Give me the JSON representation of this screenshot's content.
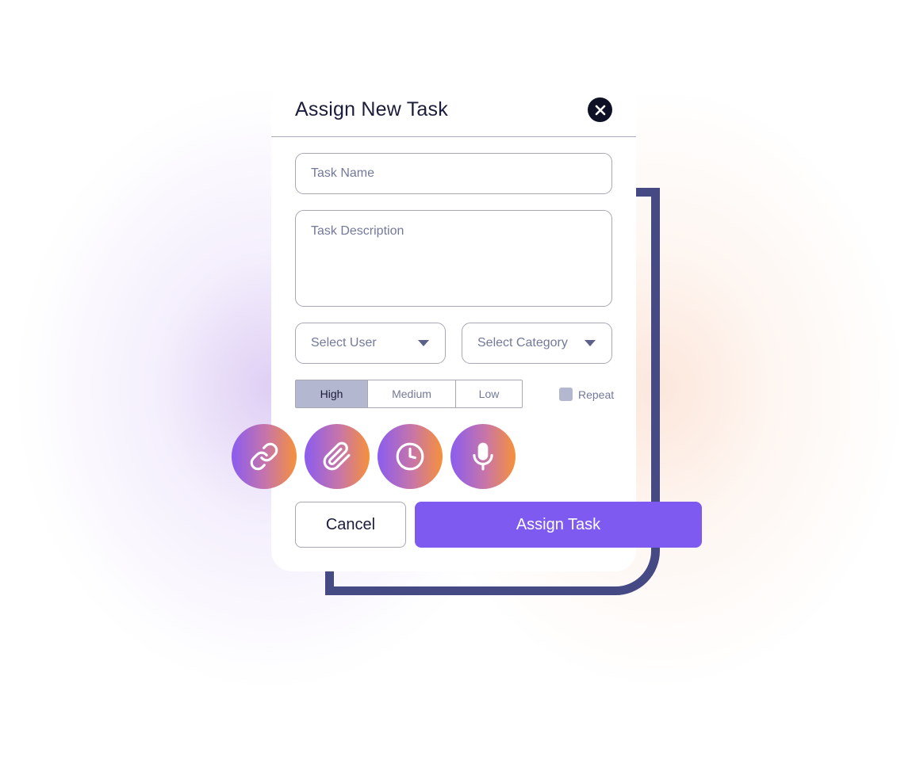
{
  "dialog": {
    "title": "Assign New Task"
  },
  "form": {
    "task_name_placeholder": "Task Name",
    "task_description_placeholder": "Task Description",
    "select_user": "Select User",
    "select_category": "Select Category"
  },
  "priority": {
    "options": [
      "High",
      "Medium",
      "Low"
    ],
    "selected": "High"
  },
  "repeat": {
    "label": "Repeat",
    "checked": false
  },
  "toolbar": {
    "icons": [
      "link-icon",
      "paperclip-icon",
      "clock-icon",
      "microphone-icon"
    ]
  },
  "actions": {
    "cancel_label": "Cancel",
    "assign_label": "Assign Task"
  },
  "colors": {
    "primary": "#7f5af0",
    "frame": "#464a84",
    "gradient_start": "#8a5cf0",
    "gradient_end": "#f6913a",
    "selected_segment": "#b4b7d0",
    "dark": "#0e1126"
  }
}
